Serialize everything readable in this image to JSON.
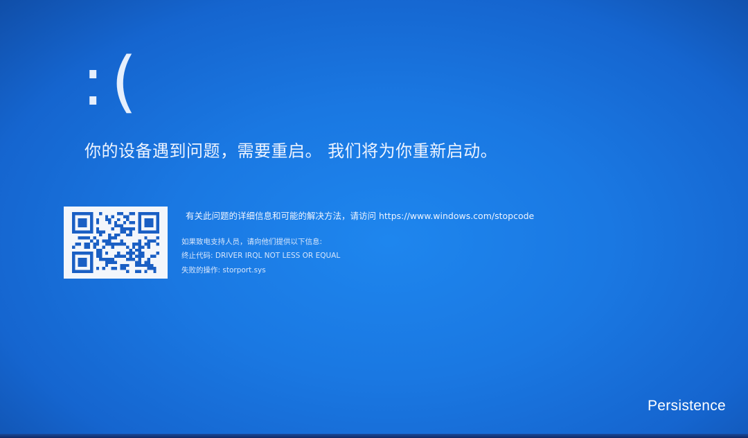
{
  "screen": {
    "emoticon": ":(",
    "headline": "你的设备遇到问题，需要重启。 我们将为你重新启动。",
    "info": "有关此问题的详细信息和可能的解决方法，请访问 https://www.windows.com/stopcode",
    "support_prompt": "如果致电支持人员，请向他们提供以下信息:",
    "stop_code": "终止代码: DRIVER IRQL NOT LESS OR EQUAL",
    "failed_operation": "失败的操作: storport.sys"
  },
  "watermark": "Persistence",
  "colors": {
    "background": "#1a78e2",
    "text": "#eaf2ff",
    "qr_background": "#f3f6fb",
    "qr_foreground": "#1a5fc4"
  },
  "icons": {
    "qr": "qr-code-icon"
  }
}
